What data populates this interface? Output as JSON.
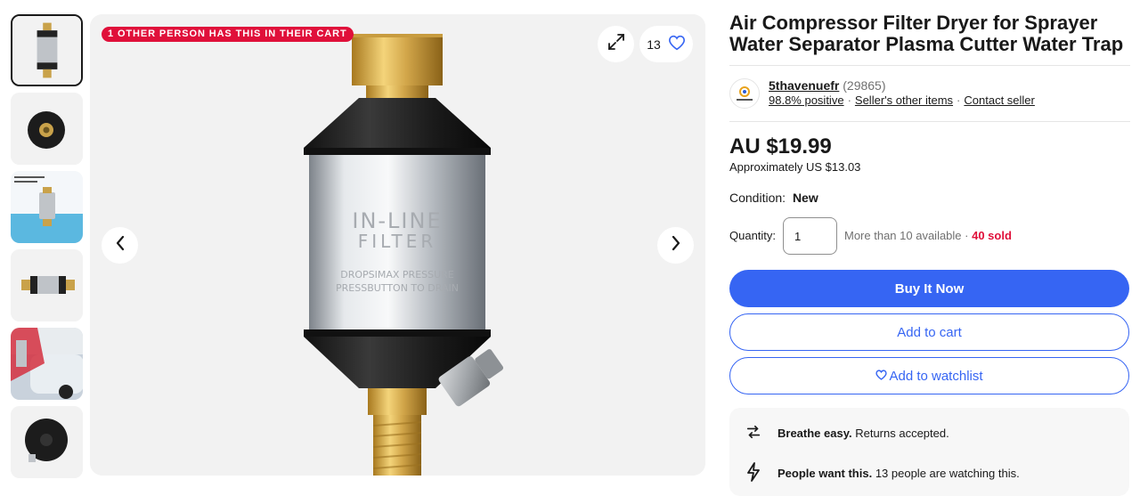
{
  "gallery": {
    "cart_banner": "1 other person has this in their cart",
    "watch_count": "13",
    "thumbnails": [
      {
        "name": "thumb-filter-front"
      },
      {
        "name": "thumb-filter-bottom"
      },
      {
        "name": "thumb-filter-water"
      },
      {
        "name": "thumb-filter-side"
      },
      {
        "name": "thumb-filter-car"
      },
      {
        "name": "thumb-filter-base"
      }
    ],
    "product_label_line1": "IN-LINE",
    "product_label_line2": "FILTER",
    "product_label_line3": "DROPSIMAX PRESSURE",
    "product_label_line4": "PRESSBUTTON TO DRAIN"
  },
  "listing": {
    "title": "Air Compressor Filter Dryer for Sprayer Water Separator Plasma Cutter Water Trap",
    "seller": {
      "name": "5thavenuefr",
      "count": "(29865)",
      "feedback": "98.8% positive",
      "other_items": "Seller's other items",
      "contact": "Contact seller"
    },
    "price": "AU $19.99",
    "approx": "Approximately US $13.03",
    "condition_label": "Condition:",
    "condition_value": "New",
    "quantity_label": "Quantity:",
    "quantity_value": "1",
    "availability": "More than 10 available",
    "sold": "40 sold",
    "buy_now": "Buy It Now",
    "add_cart": "Add to cart",
    "add_watchlist": "Add to watchlist",
    "info": [
      {
        "bold": "Breathe easy.",
        "text": "Returns accepted."
      },
      {
        "bold": "People want this.",
        "text": "13 people are watching this."
      }
    ]
  },
  "colors": {
    "accent": "#3665f3",
    "banner": "#e0103a",
    "text": "#191919",
    "muted": "#707070"
  }
}
